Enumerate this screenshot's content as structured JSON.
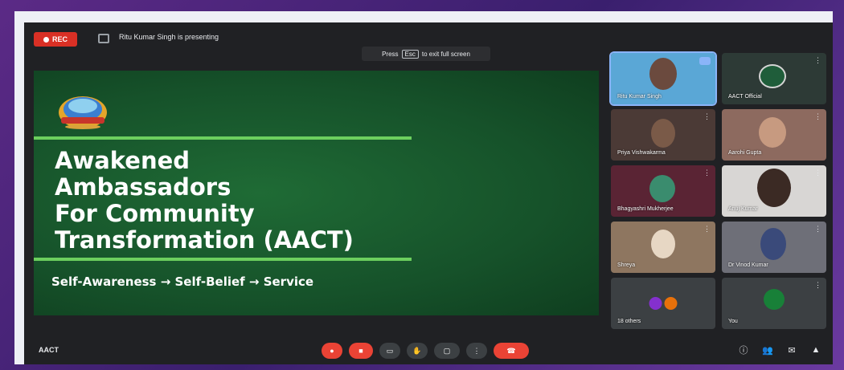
{
  "top": {
    "recording_label": "REC",
    "presenter_text": "Ritu Kumar Singh is presenting",
    "esc_hint_prefix": "Press",
    "esc_hint_key": "Esc",
    "esc_hint_suffix": "to exit full screen"
  },
  "slide": {
    "title_lines": [
      "Awakened",
      "Ambassadors",
      "For Community",
      "Transformation (AACT)"
    ],
    "subtitle": "Self-Awareness → Self-Belief → Service"
  },
  "participants": [
    {
      "name": "Ritu Kumar Singh",
      "active": true,
      "bg": "#5aa7d6"
    },
    {
      "name": "AACT Official",
      "active": false,
      "bg": "#2d3a36"
    },
    {
      "name": "Priya Vishwakarma",
      "active": false,
      "bg": "#4b3a36"
    },
    {
      "name": "Aarohi Gupta",
      "active": false,
      "bg": "#8d6a5f"
    },
    {
      "name": "Bhagyashri Mukherjee",
      "active": false,
      "bg": "#5a2434"
    },
    {
      "name": "Anuj Kumar",
      "active": false,
      "bg": "#d8d6d4"
    },
    {
      "name": "Shreya",
      "active": false,
      "bg": "#8e7660"
    },
    {
      "name": "Dr Vinod Kumar",
      "active": false,
      "bg": "#6e6f78"
    },
    {
      "name": "18 others",
      "active": false,
      "bg": "#3c4043"
    },
    {
      "name": "You",
      "active": false,
      "bg": "#3c4043"
    }
  ],
  "bottom": {
    "meeting_code": "AACT"
  },
  "colors": {
    "accent_red": "#ea4335",
    "panel_bg": "#202124",
    "slide_green": "#16522a",
    "line_green": "#6ccf5e"
  }
}
